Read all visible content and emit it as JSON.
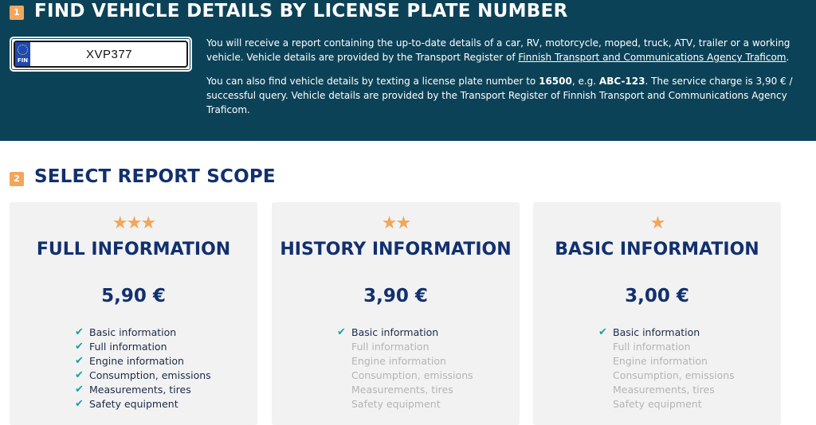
{
  "hero": {
    "step": "1",
    "title": "FIND VEHICLE DETAILS BY LICENSE PLATE NUMBER",
    "plate": {
      "country": "FIN",
      "value": "XVP377"
    },
    "paragraph1": {
      "text": "You will receive a report containing the up-to-date details of a car, RV, motorcycle, moped, truck, ATV, trailer or a working vehicle. Vehicle details are provided by the Transport Register of ",
      "link": "Finnish Transport and Communications Agency Traficom",
      "end": "."
    },
    "paragraph2": {
      "before_number": "You can also find vehicle details by texting a license plate number to ",
      "number": "16500",
      "middle": ", e.g. ",
      "example": "ABC-123",
      "after": ". The service charge is 3,90 € / successful query. Vehicle details are provided by the Transport Register of Finnish Transport and Communications Agency Traficom."
    }
  },
  "scope": {
    "step": "2",
    "title": "SELECT REPORT SCOPE",
    "cards": [
      {
        "stars": "★★★",
        "title": "FULL INFORMATION",
        "price": "5,90 €",
        "features": [
          "Basic information",
          "Full information",
          "Engine information",
          "Consumption, emissions",
          "Measurements, tires",
          "Safety equipment"
        ],
        "included": [
          true,
          true,
          true,
          true,
          true,
          true
        ]
      },
      {
        "stars": "★★",
        "title": "HISTORY INFORMATION",
        "price": "3,90 €",
        "features": [
          "Basic information",
          "Full information",
          "Engine information",
          "Consumption, emissions",
          "Measurements, tires",
          "Safety equipment"
        ],
        "included": [
          true,
          false,
          false,
          false,
          false,
          false
        ]
      },
      {
        "stars": "★",
        "title": "BASIC INFORMATION",
        "price": "3,00 €",
        "features": [
          "Basic information",
          "Full information",
          "Engine information",
          "Consumption, emissions",
          "Measurements, tires",
          "Safety equipment"
        ],
        "included": [
          true,
          false,
          false,
          false,
          false,
          false
        ]
      }
    ],
    "check_color": "#17a2a2",
    "star_color": "#f2a65a"
  },
  "colors": {
    "hero_bg": "#0c4257",
    "heading": "#12306e",
    "badge": "#f2a65a",
    "card_bg": "#f2f2f2"
  }
}
